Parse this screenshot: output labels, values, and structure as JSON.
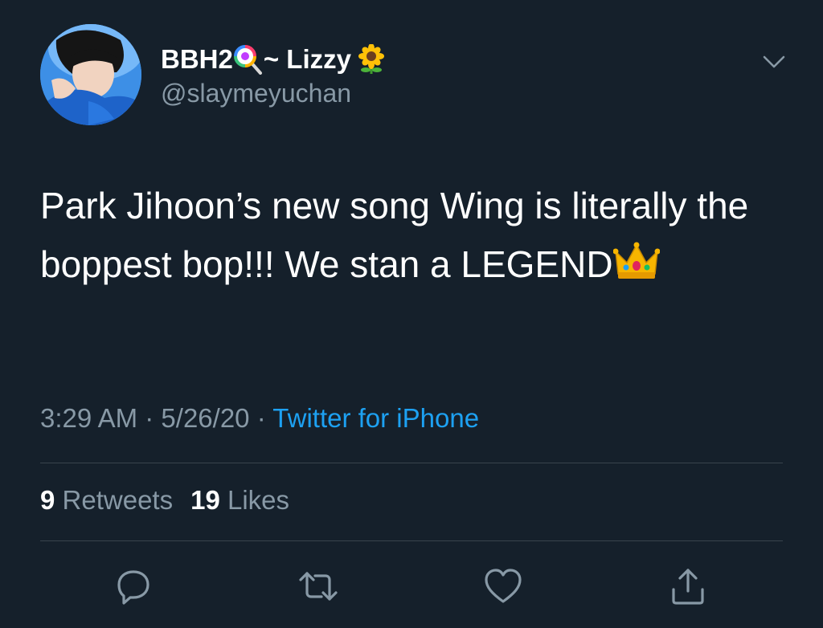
{
  "user": {
    "display_name_start": "BBH2",
    "display_name_mid": " ~ Lizzy",
    "handle": "@slaymeyuchan",
    "name_emojis": [
      "lollipop-icon",
      "sunflower-icon"
    ]
  },
  "tweet": {
    "text": "Park Jihoon’s new song Wing is literally the boppest bop!!! We stan a LEGEND",
    "trailing_emoji": "crown-icon",
    "time": "3:29 AM",
    "date": "5/26/20",
    "separator": "·",
    "source": "Twitter for iPhone"
  },
  "stats": {
    "retweets_count": "9",
    "retweets_label": "Retweets",
    "likes_count": "19",
    "likes_label": "Likes"
  },
  "actions": [
    "reply-icon",
    "retweet-icon",
    "like-icon",
    "share-icon"
  ],
  "colors": {
    "background": "#15202b",
    "text": "#ffffff",
    "secondary": "#8899a6",
    "link": "#1da1f2",
    "divider": "#38444d"
  }
}
